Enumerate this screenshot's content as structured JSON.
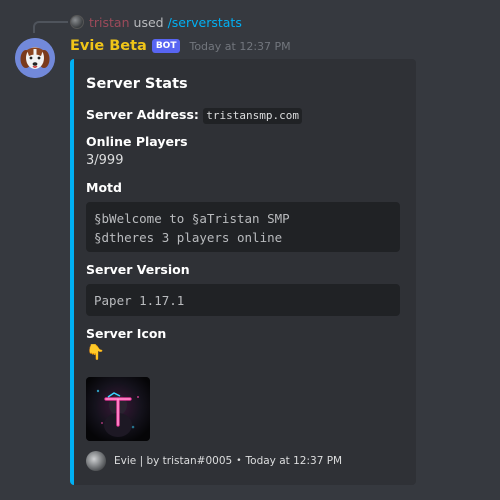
{
  "reply": {
    "username": "tristan",
    "used_text": "used",
    "command": "/serverstats"
  },
  "message": {
    "author": "Evie Beta",
    "bot_tag": "BOT",
    "timestamp": "Today at 12:37 PM"
  },
  "embed": {
    "accent_color": "#00b0f4",
    "title": "Server Stats",
    "server_address_label": "Server Address",
    "server_address_colon": ":",
    "server_address_value": "tristansmp.com",
    "online_players_label": "Online Players",
    "online_players_value": "3/999",
    "motd_label": "Motd",
    "motd_line1": "§bWelcome to §aTristan SMP",
    "motd_line2": "§dtheres 3 players online",
    "server_version_label": "Server Version",
    "server_version_value": "Paper 1.17.1",
    "server_icon_label": "Server Icon",
    "server_icon_emoji": "👇",
    "footer": {
      "text": "Evie | by tristan#0005",
      "separator": "•",
      "timestamp": "Today at 12:37 PM"
    }
  },
  "icons": {
    "reply_avatar": "user-avatar-icon",
    "bot_avatar": "dog-avatar-icon",
    "server_icon_image": "neon-t-logo-icon",
    "footer_avatar": "user-avatar-icon"
  }
}
